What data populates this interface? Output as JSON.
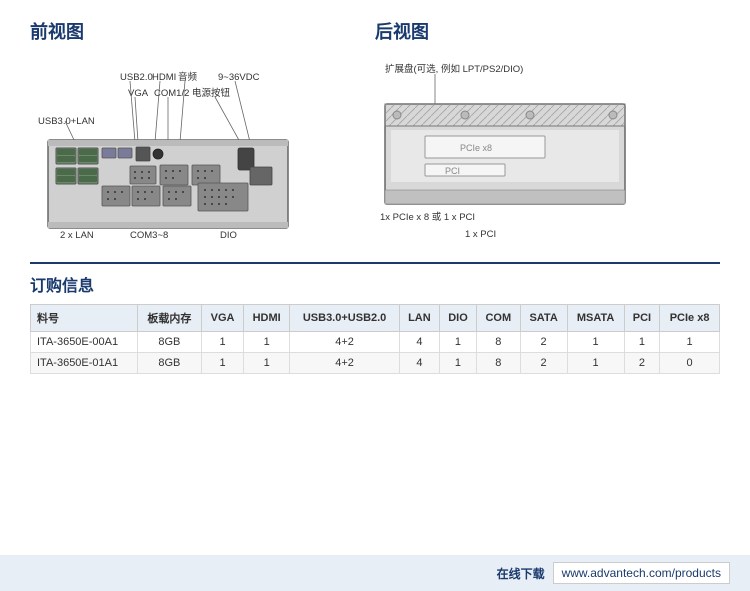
{
  "front_view": {
    "title": "前视图",
    "labels": {
      "usb30_lan": "USB3.0+LAN",
      "usb20": "USB2.0",
      "hdmi": "HDMI",
      "audio": "音频",
      "power_range": "9~36VDC",
      "vga": "VGA",
      "com12": "COM1/2",
      "power_btn": "电源按钮",
      "com38": "COM3~8",
      "dio": "DIO",
      "lan": "2 x LAN"
    }
  },
  "back_view": {
    "title": "后视图",
    "expansion_label": "扩展盘(可选, 例如 LPT/PS2/DIO)",
    "pcie_label": "1x PCIe x 8 或 1 x PCI",
    "pci_label": "1 x PCI"
  },
  "order_section": {
    "title": "订购信息",
    "columns": [
      "料号",
      "板载内存",
      "VGA",
      "HDMI",
      "USB3.0+USB2.0",
      "LAN",
      "DIO",
      "COM",
      "SATA",
      "MSATA",
      "PCI",
      "PCIe x8"
    ],
    "rows": [
      {
        "model": "ITA-3650E-00A1",
        "memory": "8GB",
        "vga": "1",
        "hdmi": "1",
        "usb": "4+2",
        "lan": "4",
        "dio": "1",
        "com": "8",
        "sata": "2",
        "msata": "1",
        "pci": "1",
        "pcie": "1"
      },
      {
        "model": "ITA-3650E-01A1",
        "memory": "8GB",
        "vga": "1",
        "hdmi": "1",
        "usb": "4+2",
        "lan": "4",
        "dio": "1",
        "com": "8",
        "sata": "2",
        "msata": "1",
        "pci": "2",
        "pcie": "0"
      }
    ]
  },
  "footer": {
    "label": "在线下载",
    "url": "www.advantech.com/products"
  }
}
